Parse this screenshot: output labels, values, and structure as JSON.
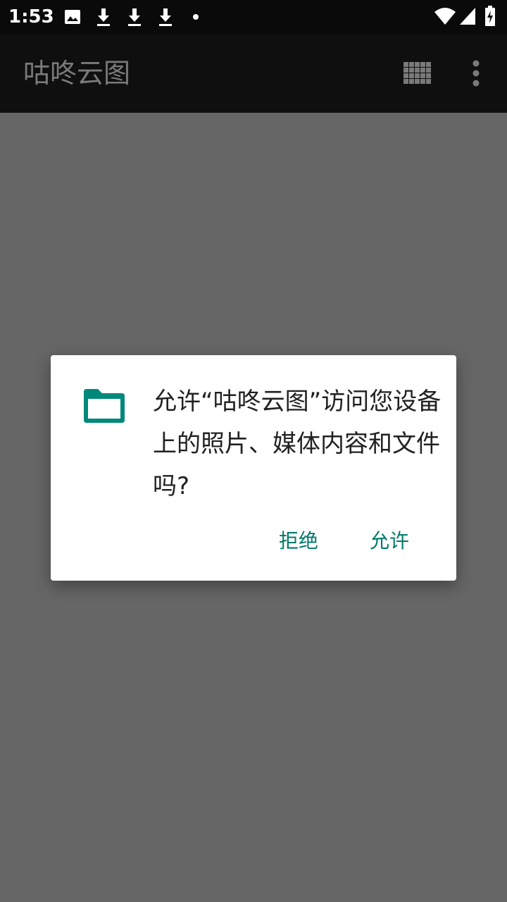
{
  "status_bar": {
    "time": "1:53",
    "icons": [
      "image-icon",
      "download-icon",
      "download-icon",
      "download-icon",
      "dot-icon",
      "wifi-icon",
      "cell-signal-icon",
      "battery-charging-icon"
    ]
  },
  "app_bar": {
    "title": "咕咚云图",
    "actions": [
      "grid-view-icon",
      "more-vert-icon"
    ]
  },
  "dialog": {
    "icon": "folder-icon",
    "message": "允许“咕咚云图”访问您设备上的照片、媒体内容和文件吗?",
    "deny_label": "拒绝",
    "allow_label": "允许"
  },
  "colors": {
    "status_bar_bg": "#0a0a0a",
    "app_bar_bg": "#0f0f0f",
    "scrim": "#666666",
    "dialog_bg": "#ffffff",
    "accent": "#00796b",
    "icon_teal": "#00897b"
  }
}
